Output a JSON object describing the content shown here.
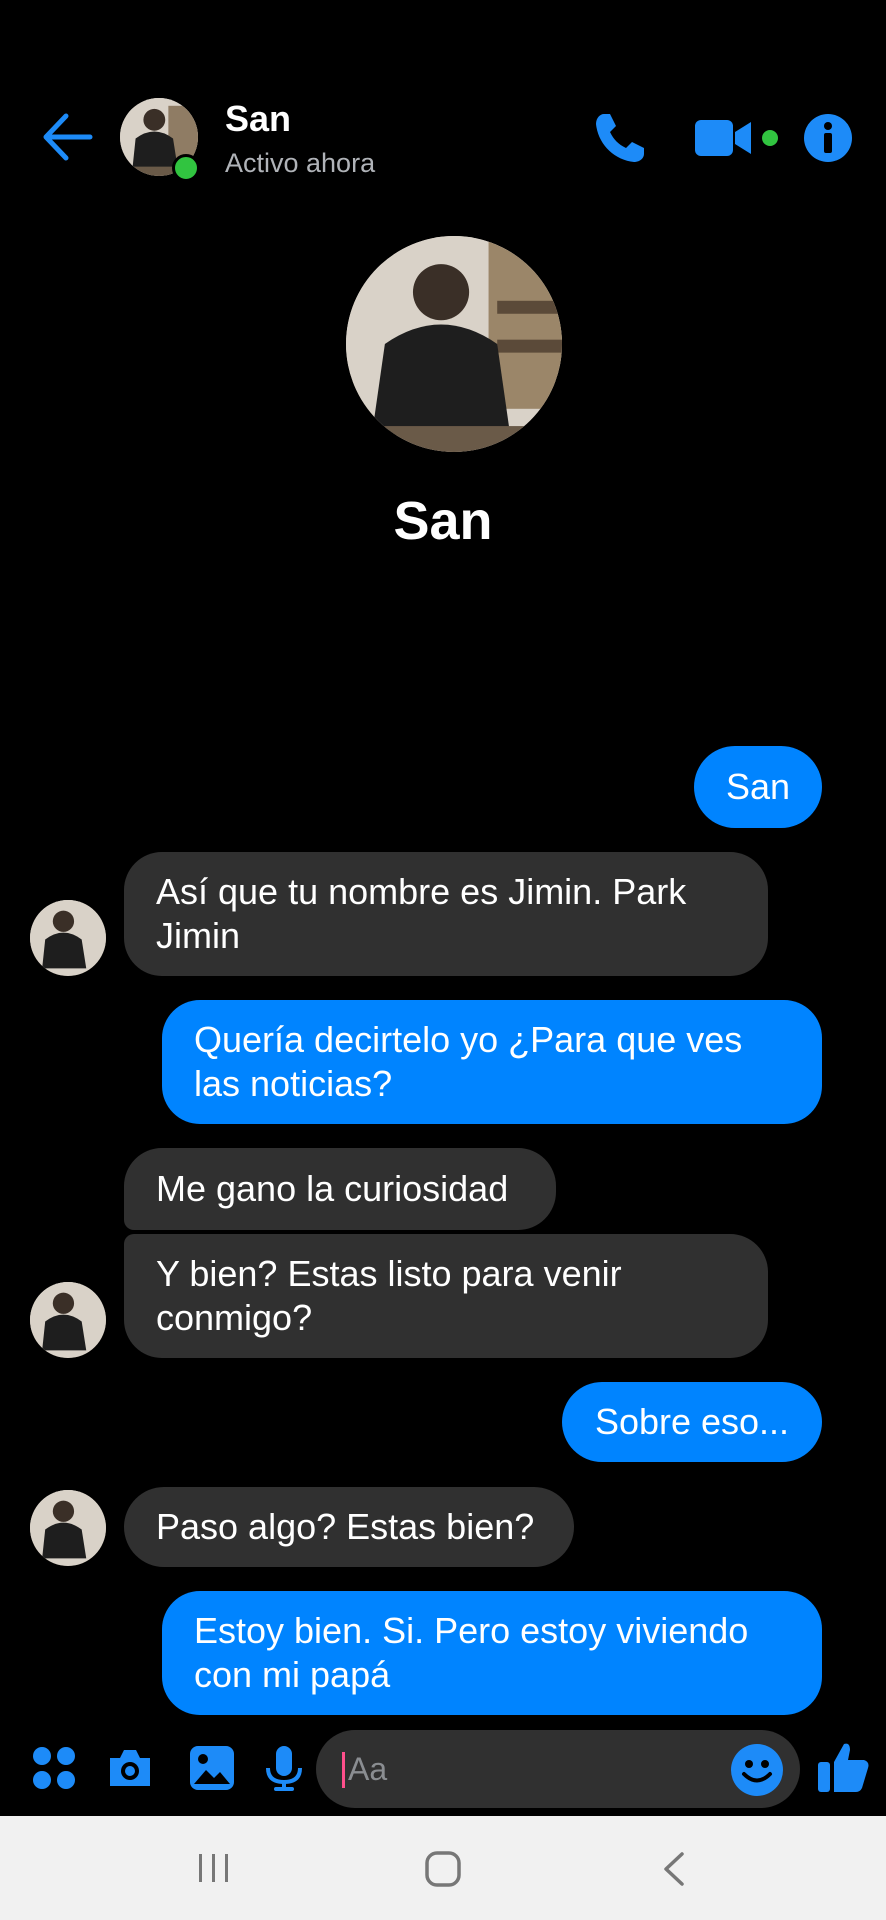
{
  "header": {
    "name": "San",
    "status": "Activo ahora"
  },
  "profile": {
    "name": "San"
  },
  "messages": [
    {
      "direction": "out",
      "text": "San"
    },
    {
      "direction": "in",
      "text": "Así que tu nombre es Jimin. Park Jimin"
    },
    {
      "direction": "out",
      "text": "Quería decirtelo yo ¿Para que ves las noticias?"
    },
    {
      "direction": "in",
      "text": "Me gano la curiosidad"
    },
    {
      "direction": "in",
      "text": "Y bien? Estas listo para venir conmigo?"
    },
    {
      "direction": "out",
      "text": "Sobre eso..."
    },
    {
      "direction": "in",
      "text": "Paso algo? Estas bien?"
    },
    {
      "direction": "out",
      "text": "Estoy bien. Si. Pero estoy viviendo con mi papá"
    }
  ],
  "composer": {
    "placeholder": "Aa"
  },
  "icons": {
    "back": "arrow-left-icon",
    "call": "phone-icon",
    "video": "video-camera-icon",
    "info": "info-icon",
    "apps": "four-dots-icon",
    "camera": "camera-icon",
    "gallery": "image-icon",
    "mic": "microphone-icon",
    "emoji": "smiley-icon",
    "like": "thumbs-up-icon",
    "recents": "recent-apps-icon",
    "home": "home-icon",
    "nav-back": "chevron-left-icon"
  },
  "colors": {
    "accent": "#0084ff",
    "background": "#000000",
    "incoming_bubble": "#303030",
    "online": "#31c440"
  }
}
